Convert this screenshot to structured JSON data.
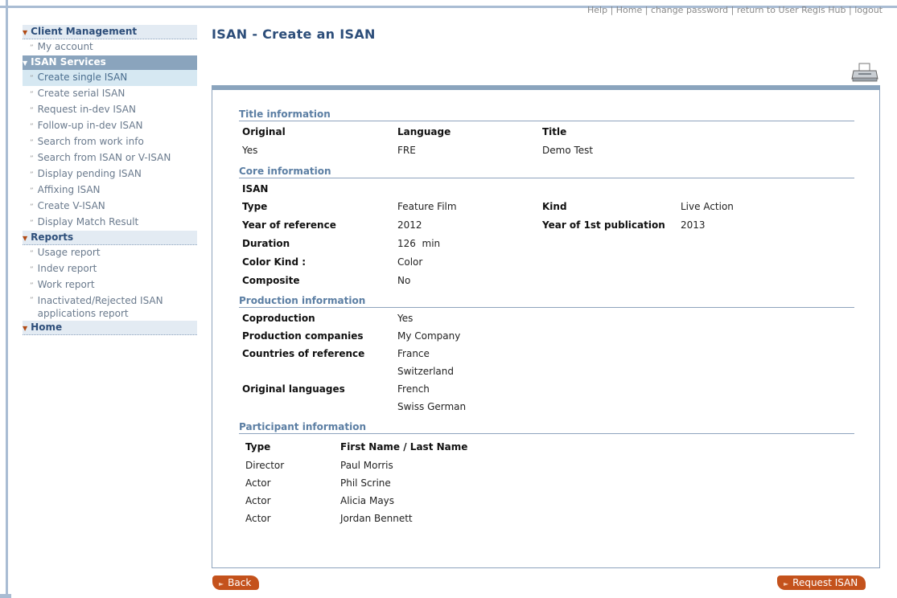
{
  "header": {
    "top_links": "Help | Home | change password | return to User Regis Hub | logout",
    "page_title": "ISAN - Create an ISAN"
  },
  "sidebar": {
    "client_management": {
      "title": "Client Management",
      "items": [
        "My account"
      ]
    },
    "isan_services": {
      "title": "ISAN Services",
      "items": [
        "Create single ISAN",
        "Create serial ISAN",
        "Request in-dev ISAN",
        "Follow-up in-dev ISAN",
        "Search from work info",
        "Search from ISAN or V-ISAN",
        "Display pending ISAN",
        "Affixing ISAN",
        "Create V-ISAN",
        "Display Match Result"
      ]
    },
    "reports": {
      "title": "Reports",
      "items": [
        "Usage report",
        "Indev report",
        "Work report"
      ],
      "last_item_line1": "Inactivated/Rejected ISAN",
      "last_item_line2": "applications report"
    },
    "home": {
      "title": "Home"
    }
  },
  "title_info": {
    "heading": "Title information",
    "col_original": "Original",
    "col_language": "Language",
    "col_title": "Title",
    "original": "Yes",
    "language": "FRE",
    "title": "Demo Test"
  },
  "core_info": {
    "heading": "Core information",
    "isan_label": "ISAN",
    "type_label": "Type",
    "type": "Feature Film",
    "kind_label": "Kind",
    "kind": "Live Action",
    "year_ref_label": "Year of reference",
    "year_ref": "2012",
    "year_pub_label": "Year of 1st publication",
    "year_pub": "2013",
    "duration_label": "Duration",
    "duration": "126  min",
    "color_label": "Color Kind :",
    "color": "Color",
    "composite_label": "Composite",
    "composite": "No"
  },
  "production_info": {
    "heading": "Production information",
    "coproduction_label": "Coproduction",
    "coproduction": "Yes",
    "companies_label": "Production companies",
    "companies": "My Company",
    "countries_label": "Countries of reference",
    "countries": [
      "France",
      "Switzerland"
    ],
    "languages_label": "Original languages",
    "languages": [
      "French",
      "Swiss German"
    ]
  },
  "participant_info": {
    "heading": "Participant information",
    "col_type": "Type",
    "col_name": "First Name / Last Name",
    "rows": [
      {
        "type": "Director",
        "name": "Paul Morris"
      },
      {
        "type": "Actor",
        "name": "Phil Scrine"
      },
      {
        "type": "Actor",
        "name": "Alicia Mays"
      },
      {
        "type": "Actor",
        "name": "Jordan Bennett"
      }
    ]
  },
  "buttons": {
    "back": "Back",
    "request": "Request ISAN"
  },
  "colors": {
    "accent_button": "#c4521c",
    "section_blue": "#5b7ea3",
    "nav_title": "#2d4e7a"
  }
}
